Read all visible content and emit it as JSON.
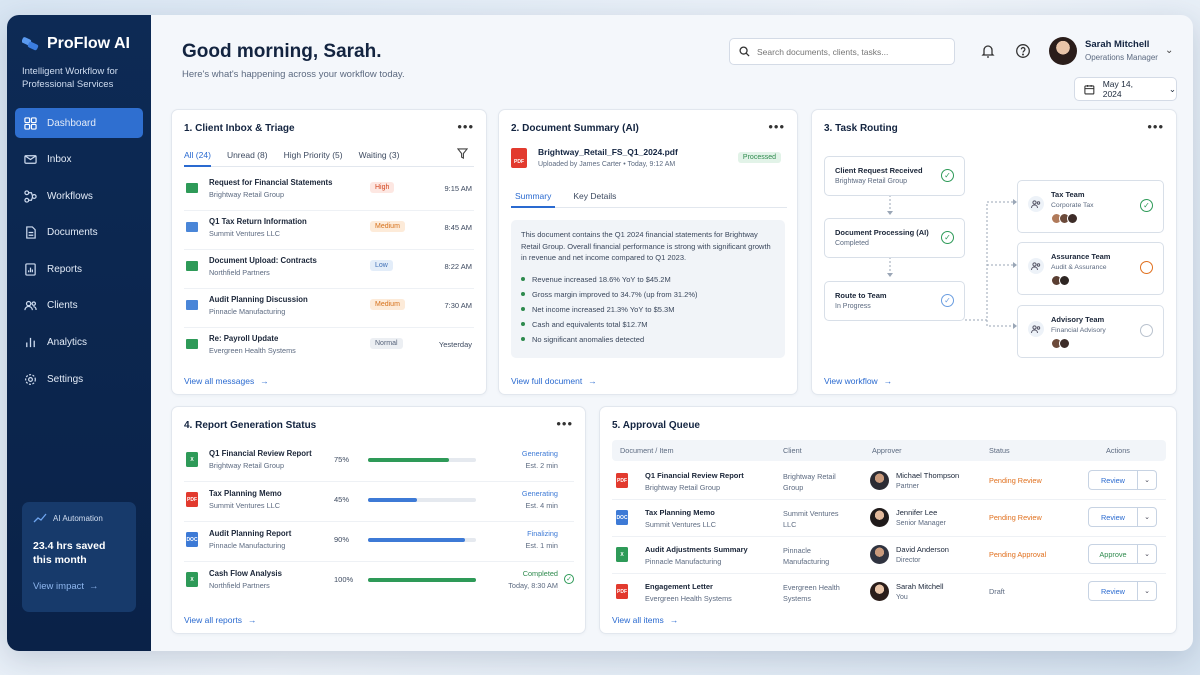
{
  "app": {
    "brand": "ProFlow AI",
    "tagline": "Intelligent Workflow for Professional Services"
  },
  "sidebar": {
    "items": [
      {
        "label": "Dashboard",
        "icon": "grid-icon",
        "active": true
      },
      {
        "label": "Inbox",
        "icon": "mail-icon"
      },
      {
        "label": "Workflows",
        "icon": "workflow-icon"
      },
      {
        "label": "Documents",
        "icon": "document-icon"
      },
      {
        "label": "Reports",
        "icon": "report-icon"
      },
      {
        "label": "Clients",
        "icon": "users-icon"
      },
      {
        "label": "Analytics",
        "icon": "bar-chart-icon"
      },
      {
        "label": "Settings",
        "icon": "gear-icon"
      }
    ],
    "automation": {
      "title": "AI Automation",
      "value": "23.4 hrs saved this month",
      "link": "View impact"
    }
  },
  "header": {
    "greeting": "Good morning, Sarah.",
    "subtitle": "Here's what's happening across your workflow today.",
    "search_placeholder": "Search documents, clients, tasks...",
    "user_name": "Sarah Mitchell",
    "user_role": "Operations Manager",
    "date": "May 14, 2024"
  },
  "inbox": {
    "title": "1. Client Inbox & Triage",
    "tabs": [
      "All (24)",
      "Unread (8)",
      "High Priority (5)",
      "Waiting (3)"
    ],
    "rows": [
      {
        "subject": "Request for Financial Statements",
        "client": "Brightway Retail Group",
        "priority": "High",
        "time": "9:15 AM",
        "icon": "sheet-mail-icon"
      },
      {
        "subject": "Q1 Tax Return Information",
        "client": "Summit Ventures LLC",
        "priority": "Medium",
        "time": "8:45 AM",
        "icon": "mail-icon"
      },
      {
        "subject": "Document Upload: Contracts",
        "client": "Northfield Partners",
        "priority": "Low",
        "time": "8:22 AM",
        "icon": "sheet-mail-icon"
      },
      {
        "subject": "Audit Planning Discussion",
        "client": "Pinnacle Manufacturing",
        "priority": "Medium",
        "time": "7:30 AM",
        "icon": "mail-icon"
      },
      {
        "subject": "Re: Payroll Update",
        "client": "Evergreen Health Systems",
        "priority": "Normal",
        "time": "Yesterday",
        "icon": "sheet-mail-icon"
      }
    ],
    "link": "View all messages"
  },
  "doc_summary": {
    "title": "2. Document Summary (AI)",
    "file_name": "Brightway_Retail_FS_Q1_2024.pdf",
    "meta": "Uploaded by James Carter  •  Today, 9:12 AM",
    "status": "Processed",
    "file_badge": "PDF",
    "tabs": [
      "Summary",
      "Key Details"
    ],
    "summary": "This document contains the Q1 2024 financial statements for Brightway Retail Group. Overall financial performance is strong with significant growth in revenue and net income compared to Q1 2023.",
    "bullets": [
      "Revenue increased 18.6% YoY to $45.2M",
      "Gross margin improved to 34.7% (up from 31.2%)",
      "Net income increased 21.3% YoY to $5.3M",
      "Cash and equivalents total $12.7M",
      "No significant anomalies detected"
    ],
    "link": "View full document"
  },
  "routing": {
    "title": "3. Task Routing",
    "steps": [
      {
        "title": "Client Request Received",
        "sub": "Brightway Retail Group"
      },
      {
        "title": "Document Processing (AI)",
        "sub": "Completed"
      },
      {
        "title": "Route to Team",
        "sub": "In Progress"
      }
    ],
    "teams": [
      {
        "name": "Tax Team",
        "sub": "Corporate Tax",
        "status": "done"
      },
      {
        "name": "Assurance Team",
        "sub": "Audit & Assurance",
        "status": "pending"
      },
      {
        "name": "Advisory Team",
        "sub": "Financial Advisory",
        "status": "idle"
      }
    ],
    "link": "View workflow"
  },
  "reports": {
    "title": "4. Report Generation Status",
    "rows": [
      {
        "name": "Q1 Financial Review Report",
        "client": "Brightway Retail Group",
        "pct": "75%",
        "progress": 0.75,
        "status": "Generating",
        "est": "Est. 2 min",
        "type": "X"
      },
      {
        "name": "Tax Planning Memo",
        "client": "Summit Ventures LLC",
        "pct": "45%",
        "progress": 0.45,
        "status": "Generating",
        "est": "Est. 4 min",
        "type": "PDF"
      },
      {
        "name": "Audit Planning Report",
        "client": "Pinnacle Manufacturing",
        "pct": "90%",
        "progress": 0.9,
        "status": "Finalizing",
        "est": "Est. 1 min",
        "type": "DOC"
      },
      {
        "name": "Cash Flow Analysis",
        "client": "Northfield Partners",
        "pct": "100%",
        "progress": 1.0,
        "status": "Completed",
        "est": "Today, 8:30 AM",
        "type": "X"
      }
    ],
    "link": "View all reports"
  },
  "approvals": {
    "title": "5. Approval Queue",
    "columns": [
      "Document / Item",
      "Client",
      "Approver",
      "Status",
      "Actions"
    ],
    "rows": [
      {
        "item": "Q1 Financial Review Report",
        "sub": "Brightway Retail Group",
        "client": "Brightway Retail Group",
        "approver": "Michael Thompson",
        "role": "Partner",
        "status": "Pending Review",
        "action": "Review",
        "type": "PDF"
      },
      {
        "item": "Tax Planning Memo",
        "sub": "Summit Ventures LLC",
        "client": "Summit Ventures LLC",
        "approver": "Jennifer Lee",
        "role": "Senior Manager",
        "status": "Pending Review",
        "action": "Review",
        "type": "DOC"
      },
      {
        "item": "Audit Adjustments Summary",
        "sub": "Pinnacle Manufacturing",
        "client": "Pinnacle Manufacturing",
        "approver": "David Anderson",
        "role": "Director",
        "status": "Pending Approval",
        "action": "Approve",
        "type": "X"
      },
      {
        "item": "Engagement Letter",
        "sub": "Evergreen Health Systems",
        "client": "Evergreen Health Systems",
        "approver": "Sarah Mitchell",
        "role": "You",
        "status": "Draft",
        "action": "Review",
        "type": "PDF"
      }
    ],
    "link": "View all items"
  },
  "colors": {
    "accent": "#2a6ad0",
    "sidebar": "#0d2a55",
    "success": "#2e9a58",
    "warning": "#e0701e"
  }
}
